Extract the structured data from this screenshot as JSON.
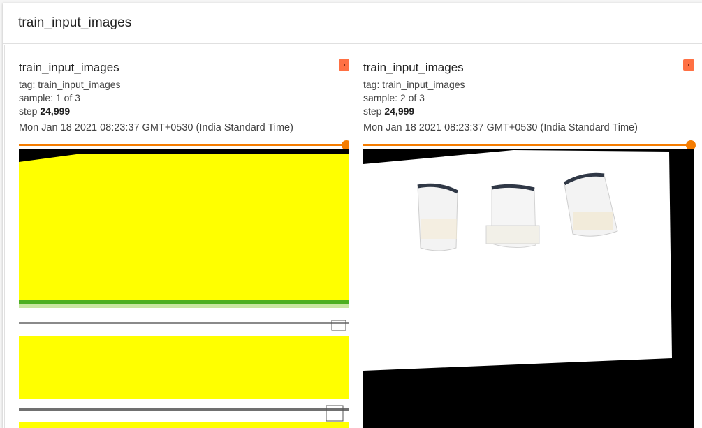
{
  "group": {
    "title": "train_input_images"
  },
  "cards": [
    {
      "title": "train_input_images",
      "tag": "tag: train_input_images",
      "sample": "sample: 1 of 3",
      "step_label": "step ",
      "step_value": "24,999",
      "timestamp": "Mon Jan 18 2021 08:23:37 GMT+0530 (India Standard Time)",
      "slider_value": 1.0,
      "image_icon": "image-yellow-strips"
    },
    {
      "title": "train_input_images",
      "tag": "tag: train_input_images",
      "sample": "sample: 2 of 3",
      "step_label": "step ",
      "step_value": "24,999",
      "timestamp": "Mon Jan 18 2021 08:23:37 GMT+0530 (India Standard Time)",
      "slider_value": 1.0,
      "image_icon": "image-three-vials"
    }
  ],
  "colors": {
    "accent": "#f57c00",
    "expand_button": "#ff7043"
  }
}
